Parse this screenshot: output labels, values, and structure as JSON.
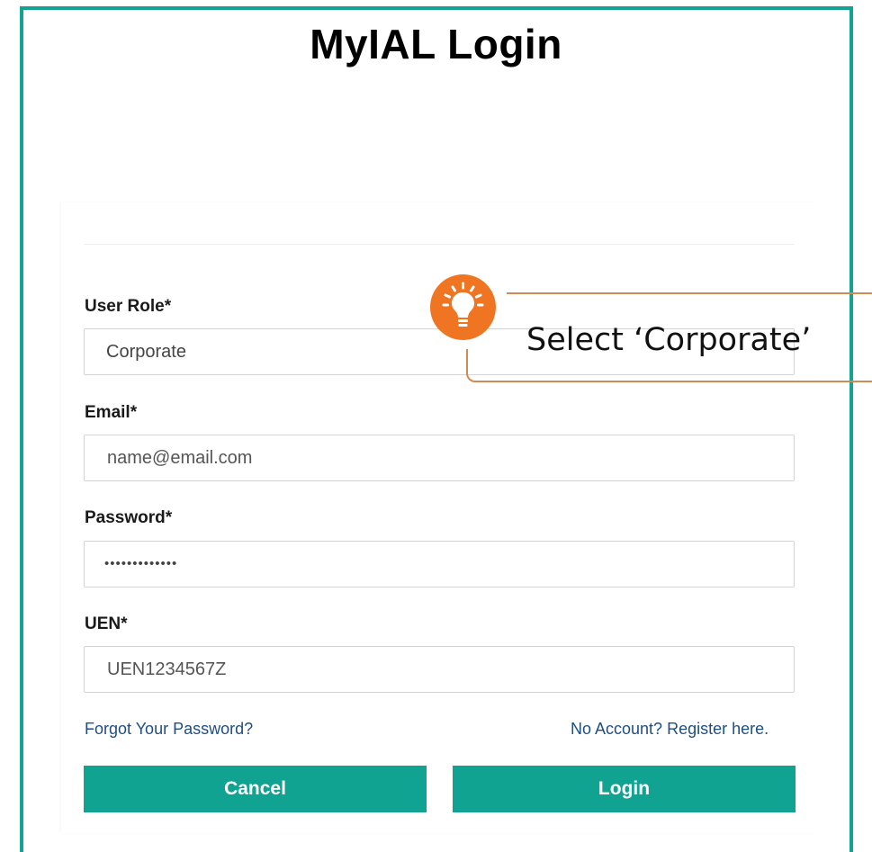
{
  "page": {
    "title": "MyIAL Login"
  },
  "form": {
    "user_role": {
      "label": "User Role*",
      "value": "Corporate"
    },
    "email": {
      "label": "Email*",
      "placeholder": "name@email.com"
    },
    "password": {
      "label": "Password*",
      "value": "•••••••••••••"
    },
    "uen": {
      "label": "UEN*",
      "value": "UEN1234567Z"
    },
    "forgot_link": "Forgot Your Password?",
    "register_link": "No Account? Register here.",
    "cancel_label": "Cancel",
    "login_label": "Login"
  },
  "tooltip": {
    "text": "Select ‘Corporate’",
    "icon": "lightbulb-icon",
    "accent": "#f07522",
    "border": "#d28a55"
  },
  "colors": {
    "frame": "#14a292",
    "button": "#10a391",
    "link": "#1e4e82"
  }
}
